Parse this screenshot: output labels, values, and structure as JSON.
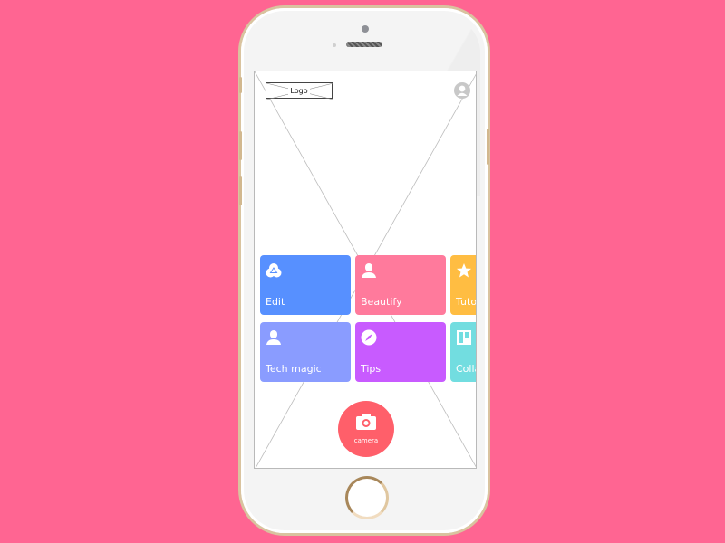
{
  "background_color": "#ff6592",
  "header": {
    "logo_label": "Logo",
    "profile_icon": "user-avatar-icon"
  },
  "tiles": [
    {
      "label": "Edit",
      "icon": "overlap-circles-icon",
      "color": "#5790ff"
    },
    {
      "label": "Beautify",
      "icon": "person-icon",
      "color": "#ff7a9c"
    },
    {
      "label": "Tuto",
      "icon": "star-icon",
      "color": "#ffbd42"
    },
    {
      "label": "Tech magic",
      "icon": "person-icon",
      "color": "#8a9cff"
    },
    {
      "label": "Tips",
      "icon": "compass-icon",
      "color": "#c85bff"
    },
    {
      "label": "Colla",
      "icon": "collage-icon",
      "color": "#72dde0"
    }
  ],
  "camera_button": {
    "label": "camera",
    "icon": "camera-icon",
    "color": "#ff5f6a"
  }
}
